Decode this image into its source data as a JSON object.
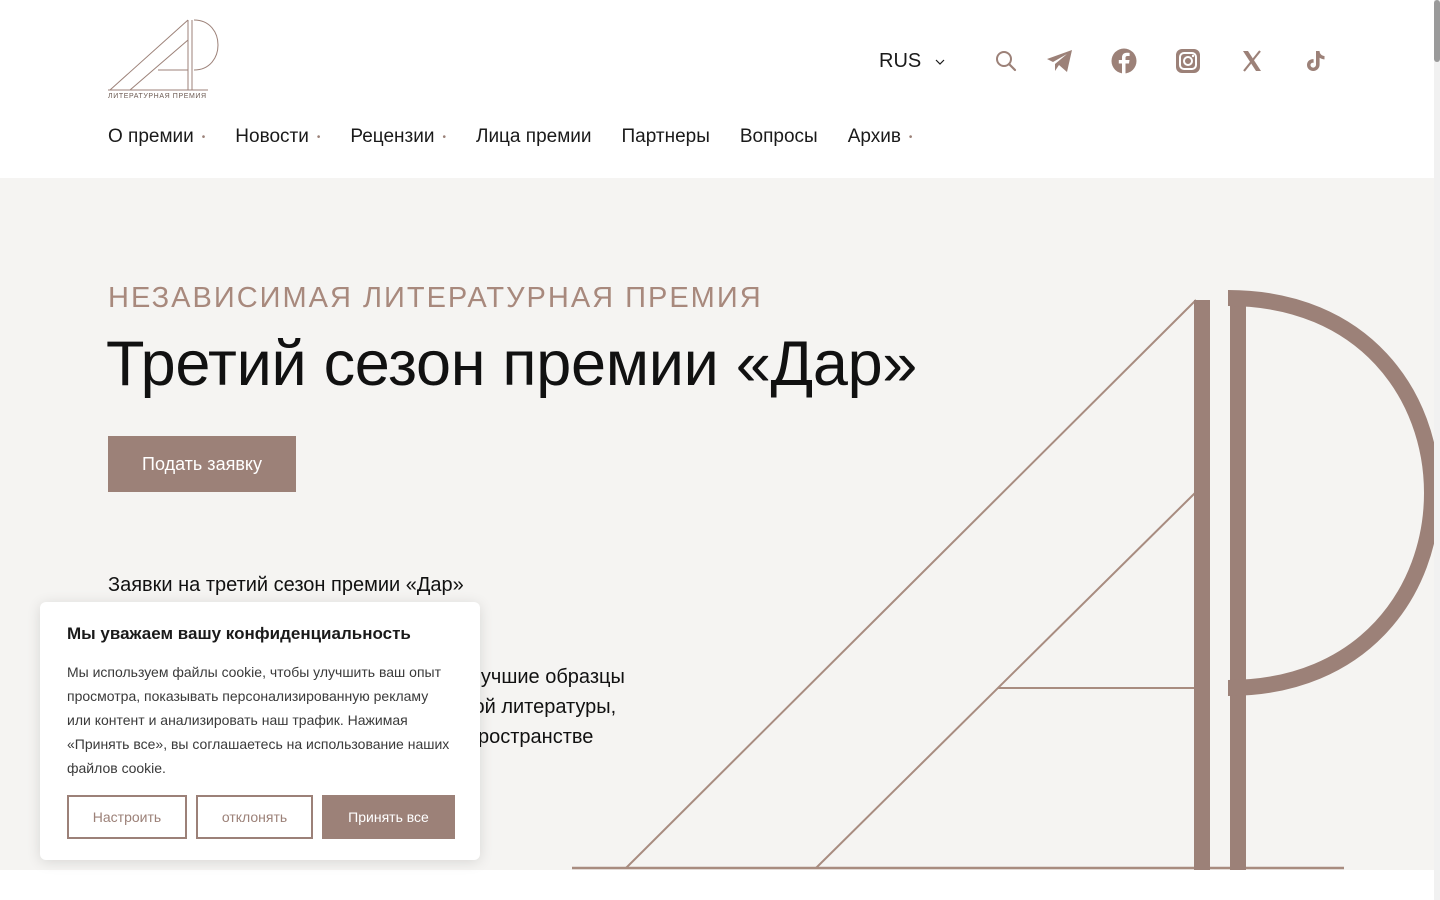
{
  "header": {
    "logo_caption": "ЛИТЕРАТУРНАЯ ПРЕМИЯ",
    "language": "RUS",
    "nav": [
      {
        "label": "О премии",
        "dropdown": true
      },
      {
        "label": "Новости",
        "dropdown": true
      },
      {
        "label": "Рецензии",
        "dropdown": true
      },
      {
        "label": "Лица премии",
        "dropdown": false
      },
      {
        "label": "Партнеры",
        "dropdown": false
      },
      {
        "label": "Вопросы",
        "dropdown": false
      },
      {
        "label": "Архив",
        "dropdown": true
      }
    ],
    "nav_dot": "•",
    "social_icons": [
      "search-icon",
      "telegram-icon",
      "facebook-icon",
      "instagram-icon",
      "x-icon",
      "tiktok-icon"
    ]
  },
  "hero": {
    "kicker": "НЕЗАВИСИМАЯ ЛИТЕРАТУРНАЯ ПРЕМИЯ",
    "title": "Третий сезон премии «Дар»",
    "cta_label": "Подать заявку",
    "subtitle": "Заявки на третий сезон премии «Дар»",
    "paragraph_fragments": [
      "л лучшие образцы",
      "чной литературы,",
      "ространстве"
    ]
  },
  "cookie": {
    "title": "Мы уважаем вашу конфиденциальность",
    "text": "Мы используем файлы cookie, чтобы улучшить ваш опыт просмотра, показывать персонализированную рекламу или контент и анализировать наш трафик. Нажимая «Принять все», вы соглашаетесь на использование наших файлов cookie.",
    "customize_label": "Настроить",
    "reject_label": "отклонять",
    "accept_label": "Принять все"
  },
  "colors": {
    "accent": "#9c8178",
    "kicker": "#a8897d",
    "hero_bg": "#f5f4f2"
  }
}
